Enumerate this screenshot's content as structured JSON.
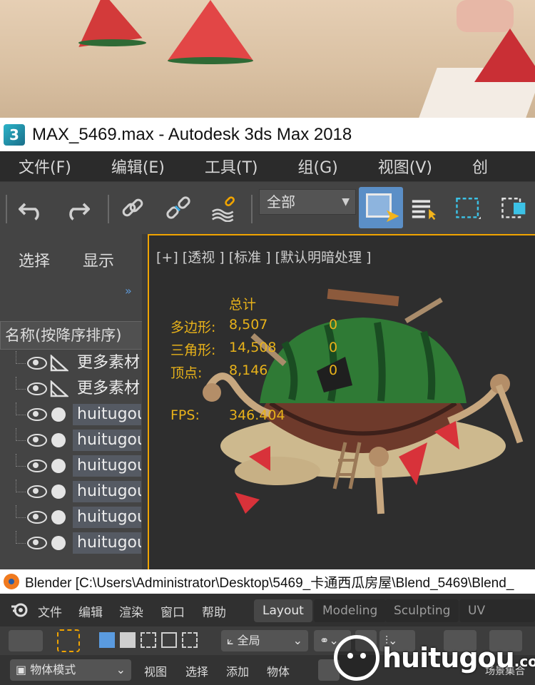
{
  "max_window": {
    "title": "MAX_5469.max - Autodesk 3ds Max 2018",
    "icon_label": "3",
    "menu": [
      "文件(F)",
      "编辑(E)",
      "工具(T)",
      "组(G)",
      "视图(V)",
      "创"
    ],
    "toolbar": {
      "selection_filter": "全部",
      "icons": [
        "undo-icon",
        "redo-icon",
        "link-icon",
        "unlink-icon",
        "bind-spacewarp-icon",
        "select-object-icon",
        "select-by-name-icon",
        "rect-selection-icon",
        "window-crossing-icon"
      ]
    },
    "scene_explorer": {
      "tabs": [
        "选择",
        "显示"
      ],
      "expand_glyph": "»",
      "column_header": "名称(按降序排序)",
      "rows": [
        {
          "name": "更多素材",
          "type": "helper"
        },
        {
          "name": "更多素材",
          "type": "helper"
        },
        {
          "name": "huitugou",
          "type": "geometry"
        },
        {
          "name": "huitugou",
          "type": "geometry"
        },
        {
          "name": "huitugou",
          "type": "geometry"
        },
        {
          "name": "huitugou",
          "type": "geometry"
        },
        {
          "name": "huitugou",
          "type": "geometry"
        },
        {
          "name": "huitugou",
          "type": "geometry"
        }
      ]
    },
    "viewport": {
      "label": "[+] [透视 ] [标准 ] [默认明暗处理 ]",
      "stats": {
        "header": "总计",
        "polygons_label": "多边形:",
        "polygons_value": "8,507",
        "polygons_sel": "0",
        "triangles_label": "三角形:",
        "triangles_value": "14,508",
        "triangles_sel": "0",
        "vertices_label": "顶点:",
        "vertices_value": "8,146",
        "vertices_sel": "0",
        "fps_label": "FPS:",
        "fps_value": "346.404"
      }
    }
  },
  "blender_window": {
    "title": "Blender [C:\\Users\\Administrator\\Desktop\\5469_卡通西瓜房屋\\Blend_5469\\Blend_",
    "menu": [
      "文件",
      "编辑",
      "渲染",
      "窗口",
      "帮助"
    ],
    "workspaces": [
      "Layout",
      "Modeling",
      "Sculpting",
      "UV Editing"
    ],
    "active_workspace": "Layout",
    "toolbar": {
      "transform_orientation": "全局"
    },
    "header": {
      "mode": "物体模式",
      "menus": [
        "视图",
        "选择",
        "添加",
        "物体"
      ],
      "scene_label": "场景集合"
    }
  },
  "watermark": {
    "text": "huitugou",
    "suffix": ".com"
  },
  "colors": {
    "max_dark": "#2b2b2b",
    "max_panel": "#444444",
    "viewport_border": "#f0a400",
    "stat_text": "#e8b21a",
    "select_active": "#5b8fc7",
    "blender_dark": "#303030"
  }
}
